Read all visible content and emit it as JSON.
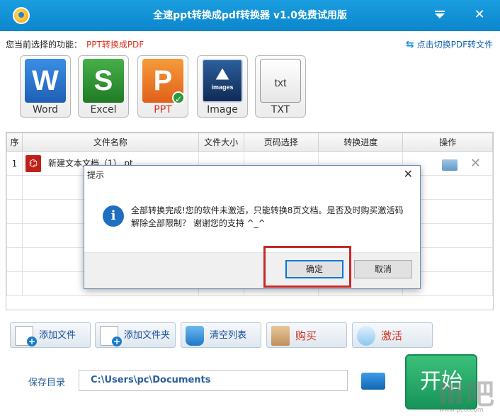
{
  "window": {
    "title": "全速ppt转换成pdf转换器 v1.0免费试用版",
    "min_label": "",
    "close_label": "✕"
  },
  "function_line": {
    "label": "您当前选择的功能：",
    "value": "PPT转换成PDF"
  },
  "switch_link": {
    "label": "点击切换PDF转文件",
    "icon": "swap-arrows-icon"
  },
  "tiles": [
    {
      "name": "word",
      "glyph": "W",
      "label": "Word"
    },
    {
      "name": "excel",
      "glyph": "S",
      "label": "Excel"
    },
    {
      "name": "ppt",
      "glyph": "P",
      "label": "PPT",
      "selected": true
    },
    {
      "name": "image",
      "glyph": "images",
      "label": "Image"
    },
    {
      "name": "txt",
      "glyph": "txt",
      "label": "TXT"
    }
  ],
  "table": {
    "headers": [
      "序",
      "文件名称",
      "文件大小",
      "页码选择",
      "转换进度",
      "操作"
    ],
    "rows": [
      {
        "index": "1",
        "filename": "新建文本文档（1）.pt",
        "size": "",
        "pages": "",
        "progress": ""
      }
    ]
  },
  "buttons": {
    "add_file": "添加文件",
    "add_folder": "添加文件夹",
    "clear": "清空列表",
    "buy": "购买",
    "activate": "激活",
    "start": "开始"
  },
  "save": {
    "label": "保存目录",
    "path": "C:\\Users\\pc\\Documents"
  },
  "dialog": {
    "title": "提示",
    "close": "✕",
    "icon_glyph": "i",
    "message": "全部转换完成!您的软件未激活，只能转换8页文档。是否及时购买激活码解除全部限制？ 谢谢您的支持 ^_^",
    "ok": "确定",
    "cancel": "取消"
  },
  "watermark": {
    "text": "Ⅲ吧",
    "sub": "www.pc6.com"
  },
  "colors": {
    "titlebar": "#1592d8",
    "accent_red": "#e03020",
    "start_green": "#22a864",
    "highlight": "#c42a2a"
  }
}
